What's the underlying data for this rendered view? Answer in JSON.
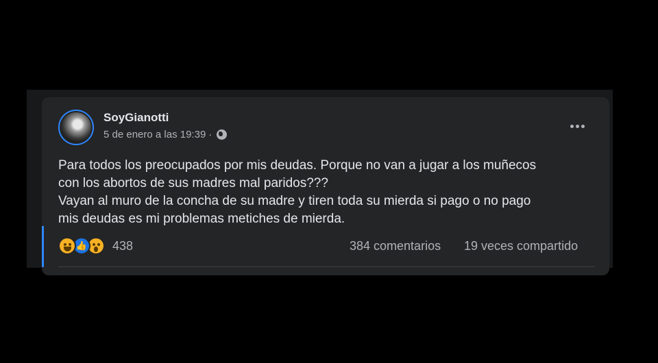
{
  "post": {
    "author": "SoyGianotti",
    "timestamp": "5 de enero a las 19:39",
    "separator": "·",
    "privacy_icon": "globe-icon",
    "more_icon": "more-options-icon",
    "body_lines": [
      "Para todos los preocupados por mis deudas. Porque no van a jugar a los muñecos",
      "con los abortos de sus madres mal paridos???",
      "Vayan al muro de la concha de su madre y tiren toda su mierda si pago o no pago",
      "mis deudas es mi problemas metiches de mierda."
    ],
    "reactions": {
      "types": [
        "haha",
        "like",
        "wow"
      ],
      "count": "438"
    },
    "comments": "384 comentarios",
    "shares": "19 veces compartido"
  },
  "colors": {
    "background": "#000000",
    "card": "#242526",
    "text_primary": "#e4e6eb",
    "text_secondary": "#b0b3b8",
    "accent": "#2d88ff"
  }
}
